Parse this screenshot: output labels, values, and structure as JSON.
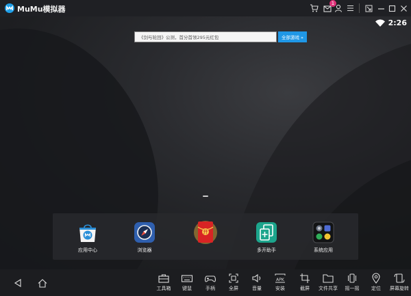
{
  "titlebar": {
    "app_title": "MuMu模拟器",
    "message_badge": "1"
  },
  "statusbar": {
    "time": "2:26"
  },
  "search": {
    "placeholder": "《剑与轮回》公测，首分首领295元红包",
    "button_label": "全部游戏 »"
  },
  "dock": {
    "apps": [
      {
        "label": "应用中心",
        "icon": "app-center-bag-icon"
      },
      {
        "label": "浏览器",
        "icon": "browser-compass-icon"
      },
      {
        "label": "",
        "icon": "red-envelope-icon",
        "glyph": "开"
      },
      {
        "label": "多开助手",
        "icon": "multi-open-icon"
      },
      {
        "label": "系统应用",
        "icon": "system-apps-folder-icon"
      }
    ]
  },
  "toolbar": {
    "tools": [
      {
        "label": "工具箱",
        "icon": "toolbox-icon"
      },
      {
        "label": "键鼠",
        "icon": "keyboard-icon"
      },
      {
        "label": "手柄",
        "icon": "gamepad-icon"
      },
      {
        "label": "全屏",
        "icon": "fullscreen-icon"
      },
      {
        "label": "音量",
        "icon": "volume-icon"
      },
      {
        "label": "安装",
        "icon": "apk-install-icon",
        "icon_text": "APK"
      },
      {
        "label": "截屏",
        "icon": "crop-screenshot-icon"
      },
      {
        "label": "文件共享",
        "icon": "folder-share-icon"
      },
      {
        "label": "摇一摇",
        "icon": "shake-icon"
      },
      {
        "label": "定位",
        "icon": "location-pin-icon"
      },
      {
        "label": "屏幕旋转",
        "icon": "rotate-screen-icon"
      }
    ]
  },
  "colors": {
    "accent": "#1f97e6",
    "badge": "#e0337a"
  }
}
